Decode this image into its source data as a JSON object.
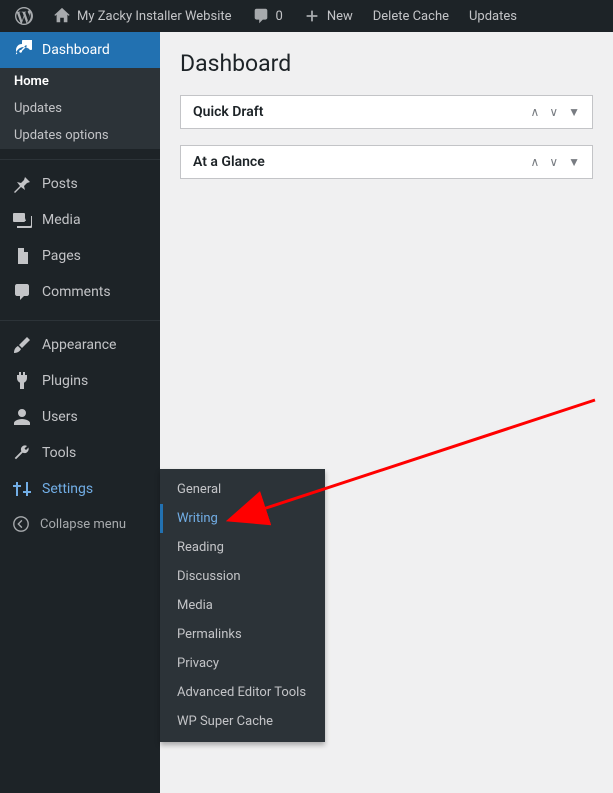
{
  "toolbar": {
    "site_name": "My Zacky Installer Website",
    "comments_count": "0",
    "new_label": "New",
    "delete_cache": "Delete Cache",
    "updates": "Updates"
  },
  "sidebar": {
    "items": [
      {
        "label": "Dashboard"
      },
      {
        "label": "Posts"
      },
      {
        "label": "Media"
      },
      {
        "label": "Pages"
      },
      {
        "label": "Comments"
      },
      {
        "label": "Appearance"
      },
      {
        "label": "Plugins"
      },
      {
        "label": "Users"
      },
      {
        "label": "Tools"
      },
      {
        "label": "Settings"
      }
    ],
    "dashboard_sub": [
      {
        "label": "Home"
      },
      {
        "label": "Updates"
      },
      {
        "label": "Updates options"
      }
    ],
    "collapse": "Collapse menu"
  },
  "settings_submenu": [
    {
      "label": "General"
    },
    {
      "label": "Writing"
    },
    {
      "label": "Reading"
    },
    {
      "label": "Discussion"
    },
    {
      "label": "Media"
    },
    {
      "label": "Permalinks"
    },
    {
      "label": "Privacy"
    },
    {
      "label": "Advanced Editor Tools"
    },
    {
      "label": "WP Super Cache"
    }
  ],
  "content": {
    "title": "Dashboard",
    "boxes": [
      {
        "title": "Quick Draft"
      },
      {
        "title": "At a Glance"
      }
    ]
  }
}
